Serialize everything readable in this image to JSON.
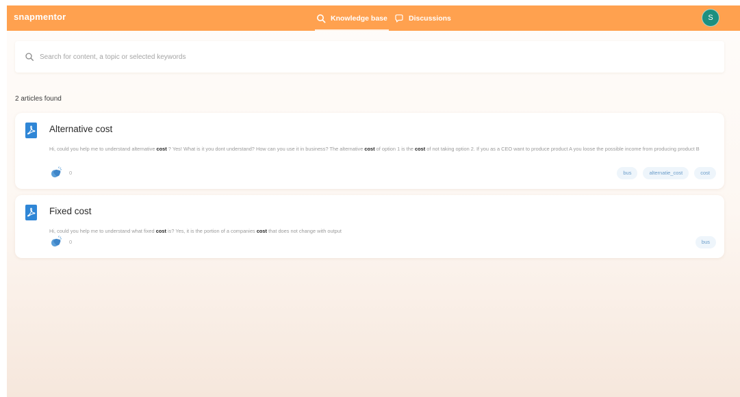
{
  "header": {
    "logo": "snapmentor",
    "nav": [
      {
        "label": "Knowledge base",
        "icon": "search-icon",
        "active": true
      },
      {
        "label": "Discussions",
        "icon": "chat-bubble-icon",
        "active": false
      }
    ],
    "avatar_initial": "S",
    "bar_color": "#ffa14f",
    "avatar_color": "#1d8f7f"
  },
  "search": {
    "placeholder": "Search for content, a topic or selected keywords",
    "value": ""
  },
  "results": {
    "count_label": "2 articles found",
    "articles": [
      {
        "title": "Alternative cost",
        "icon": "pdf-icon",
        "excerpt": [
          {
            "t": "Hi, could you help me to understand alternative ",
            "bold": false
          },
          {
            "t": "cost",
            "bold": true
          },
          {
            "t": " ? Yes! What is it you dont understand? How can you use it in business? The alternative ",
            "bold": false
          },
          {
            "t": "cost",
            "bold": true
          },
          {
            "t": " of option 1 is the ",
            "bold": false
          },
          {
            "t": "cost",
            "bold": true
          },
          {
            "t": " of not taking option 2. If you as a CEO want to produce product A you loose the possible income from producing product B",
            "bold": false
          }
        ],
        "likes": "0",
        "tags": [
          "bus",
          "alternatie_cost",
          "cost"
        ]
      },
      {
        "title": "Fixed cost",
        "icon": "pdf-icon",
        "excerpt": [
          {
            "t": "Hi, could you help me to understand what fixed ",
            "bold": false
          },
          {
            "t": "cost",
            "bold": true
          },
          {
            "t": " is? Yes, it is the portion of a companies ",
            "bold": false
          },
          {
            "t": "cost",
            "bold": true
          },
          {
            "t": " that does not change with output",
            "bold": false
          }
        ],
        "likes": "0",
        "tags": [
          "bus"
        ]
      }
    ]
  }
}
